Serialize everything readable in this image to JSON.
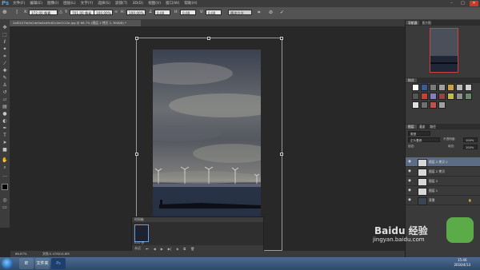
{
  "app": {
    "logo": "Ps"
  },
  "menu": [
    "文件(F)",
    "编辑(E)",
    "图像(I)",
    "图层(L)",
    "文字(Y)",
    "选择(S)",
    "滤镜(T)",
    "3D(D)",
    "视图(V)",
    "窗口(W)",
    "帮助(H)"
  ],
  "options": {
    "x_label": "X:",
    "x_value": "372.00 像素",
    "y_label": "Y:",
    "y_value": "701.00 像素",
    "w_label": "W:",
    "w_value": "100.00%",
    "h_label": "H:",
    "h_value": "100.00%",
    "angle_value": "0.00",
    "h_skew_label": "H:",
    "h_skew_value": "0.00",
    "v_skew_label": "V:",
    "v_skew_value": "0.00",
    "interp_value": "两次立方"
  },
  "document_tab": "2af0107fa5e2de9a4ed9c62c0e0122e.jpg @ 66.7% (图层 2 拷贝 2, RGB/8) *",
  "timeline": {
    "title": "时间轴",
    "frame_time": "0.07 秒",
    "loop": "永远"
  },
  "status": {
    "zoom": "66.67%",
    "doc_size": "文档:2.47M/14.8M"
  },
  "panels": {
    "navigator_tabs": [
      "导航器",
      "直方图"
    ],
    "styles_tabs": [
      "样式"
    ],
    "layers_tabs": [
      "图层",
      "通道",
      "路径"
    ],
    "layer_kind": "类型",
    "blend_mode": "正片叠底",
    "opacity_label": "不透明度:",
    "opacity_value": "100%",
    "fill_label": "填充:",
    "fill_value": "100%",
    "lock_label": "锁定:",
    "layers": [
      {
        "name": "图层 2 拷贝 2",
        "selected": true
      },
      {
        "name": "图层 2 拷贝",
        "selected": false
      },
      {
        "name": "图层 2",
        "selected": false
      },
      {
        "name": "图层 1",
        "selected": false
      },
      {
        "name": "背景",
        "selected": false
      }
    ]
  },
  "taskbar": {
    "apps": [
      "IE",
      "文件夹",
      "Ps"
    ],
    "time": "15:46",
    "date": "2016/4/13"
  },
  "watermark": {
    "brand": "Baidu 经验",
    "url": "jingyan.baidu.com"
  },
  "colors": {
    "accent": "#4fa3e8",
    "selected_layer": "#5c6c84",
    "close_button": "#c43a2c"
  }
}
